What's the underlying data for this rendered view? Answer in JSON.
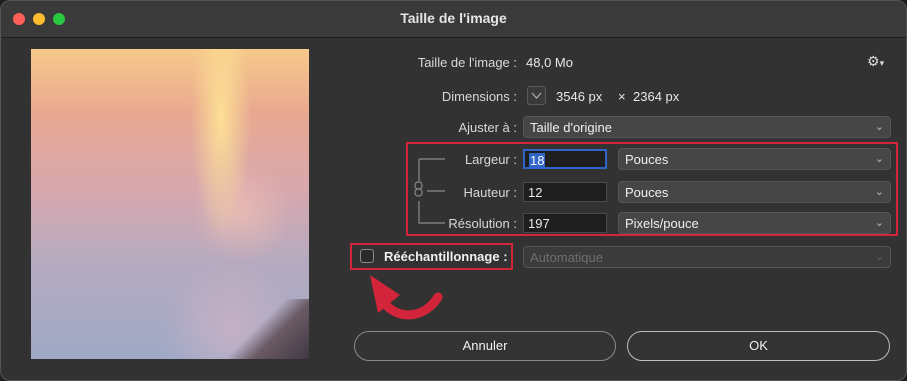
{
  "window": {
    "title": "Taille de l'image"
  },
  "info": {
    "size_label": "Taille de l'image :",
    "size_value": "48,0 Mo",
    "dimensions_label": "Dimensions :",
    "dimensions_width": "3546 px",
    "dimensions_sep": "×",
    "dimensions_height": "2364 px"
  },
  "fit": {
    "label": "Ajuster à :",
    "value": "Taille d'origine"
  },
  "width": {
    "label": "Largeur :",
    "value": "18",
    "unit": "Pouces"
  },
  "height": {
    "label": "Hauteur :",
    "value": "12",
    "unit": "Pouces"
  },
  "resolution": {
    "label": "Résolution :",
    "value": "197",
    "unit": "Pixels/pouce"
  },
  "resample": {
    "label": "Rééchantillonnage :",
    "checked": false,
    "value": "Automatique"
  },
  "buttons": {
    "cancel": "Annuler",
    "ok": "OK"
  },
  "colors": {
    "annotation": "#d3253a",
    "highlight": "#2f65c9"
  },
  "icons": {
    "gear": "gear-icon",
    "chain": "chain-link-icon",
    "chevron": "chevron-down-icon"
  }
}
